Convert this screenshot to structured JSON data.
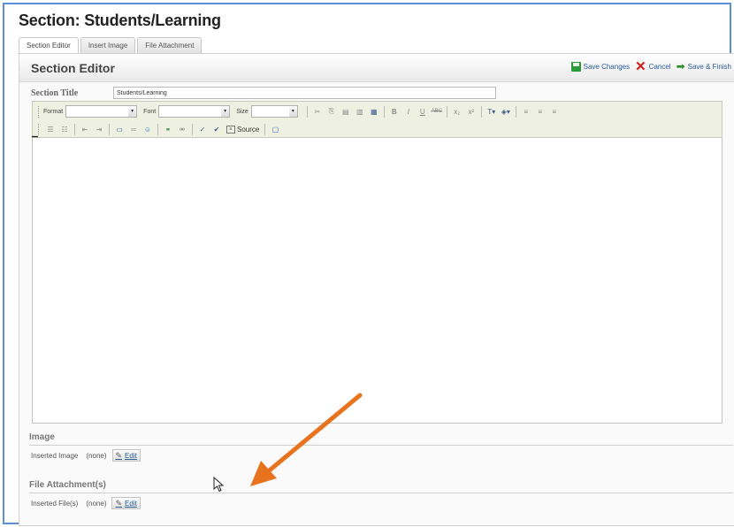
{
  "page": {
    "title": "Section: Students/Learning"
  },
  "tabs": [
    {
      "label": "Section Editor",
      "active": true
    },
    {
      "label": "Insert Image",
      "active": false
    },
    {
      "label": "File Attachment",
      "active": false
    }
  ],
  "editor": {
    "heading": "Section Editor",
    "actions": {
      "save_changes": "Save Changes",
      "cancel": "Cancel",
      "save_finish": "Save & Finish"
    },
    "section_title": {
      "label": "Section Title",
      "value": "Students/Learning"
    }
  },
  "toolbar": {
    "format_label": "Format",
    "font_label": "Font",
    "size_label": "Size",
    "source_label": "Source",
    "icons_row1": [
      "cut-icon",
      "copy-icon",
      "paste-icon",
      "paste-text-icon",
      "paste-word-icon",
      "bold-icon",
      "italic-icon",
      "underline-icon",
      "strikethrough-icon",
      "subscript-icon",
      "superscript-icon",
      "text-color-icon",
      "bg-color-icon",
      "align-left-icon",
      "align-center-icon",
      "align-right-icon"
    ],
    "icons_row2": [
      "numbered-list-icon",
      "bulleted-list-icon",
      "outdent-icon",
      "indent-icon",
      "table-icon",
      "horizontal-rule-icon",
      "smiley-icon",
      "link-icon",
      "unlink-icon",
      "spell-check-icon",
      "spell-check-abc-icon",
      "source-icon",
      "maximize-icon"
    ]
  },
  "image_section": {
    "heading": "Image",
    "field_label": "Inserted Image",
    "value": "(none)",
    "edit_label": "Edit"
  },
  "file_section": {
    "heading": "File Attachment(s)",
    "field_label": "Inserted File(s)",
    "value": "(none)",
    "edit_label": "Edit"
  },
  "colors": {
    "frame": "#5b8fd6",
    "annotation_arrow": "#e8731e",
    "cancel": "#d21a1a",
    "save": "#2a9a3a"
  }
}
